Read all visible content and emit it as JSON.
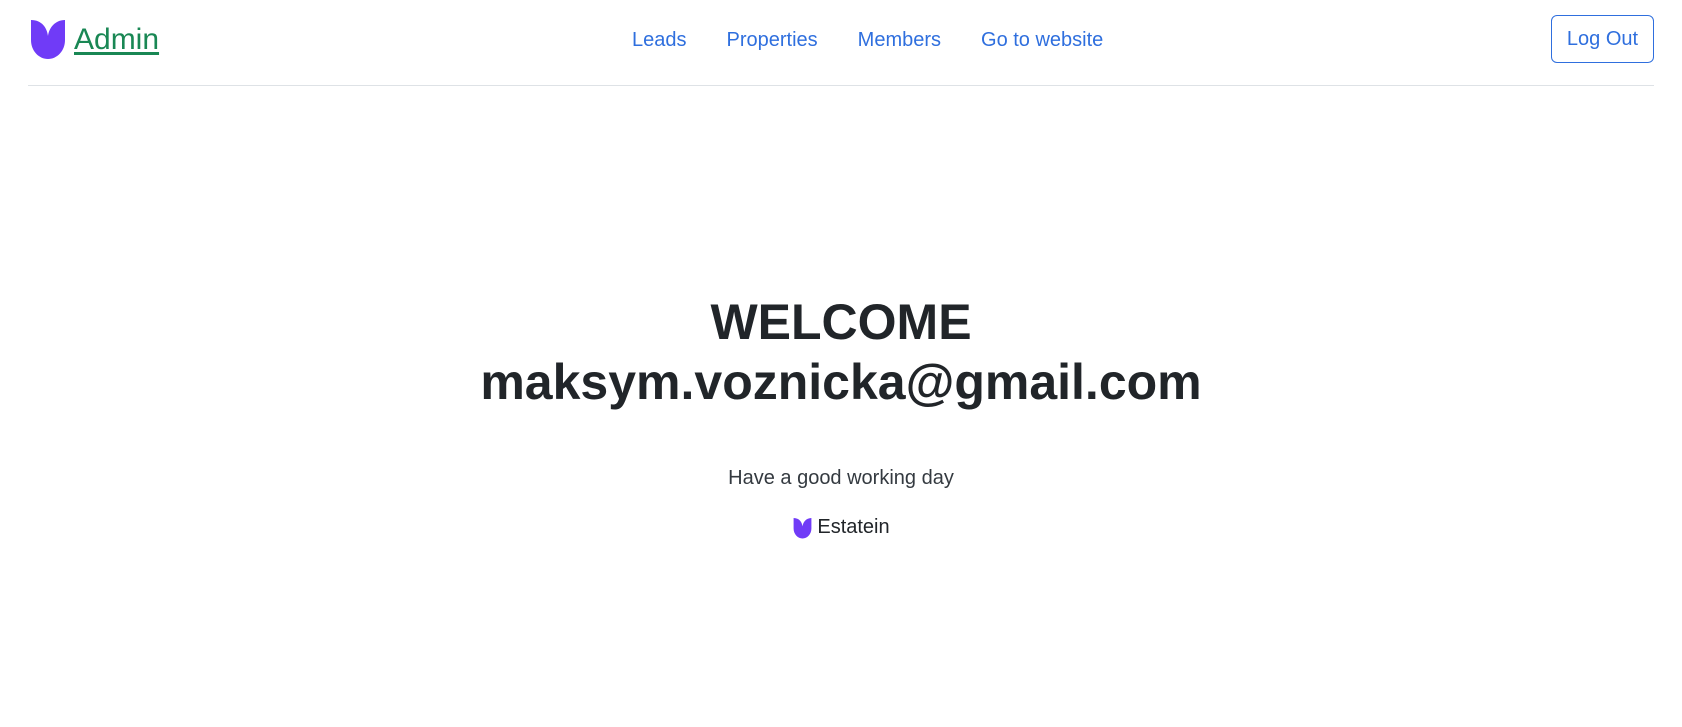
{
  "header": {
    "brand_label": "Admin",
    "logo_icon": "estatein-leaf-icon",
    "nav": [
      {
        "label": "Leads"
      },
      {
        "label": "Properties"
      },
      {
        "label": "Members"
      },
      {
        "label": "Go to website"
      }
    ],
    "logout_label": "Log Out"
  },
  "main": {
    "welcome": "WELCOME",
    "email": "maksym.voznicka@gmail.com",
    "subtitle": "Have a good working day",
    "footer_brand": "Estatein"
  },
  "colors": {
    "brand_purple": "#703bf7",
    "link_blue": "#2f6fde",
    "admin_green": "#198754"
  }
}
